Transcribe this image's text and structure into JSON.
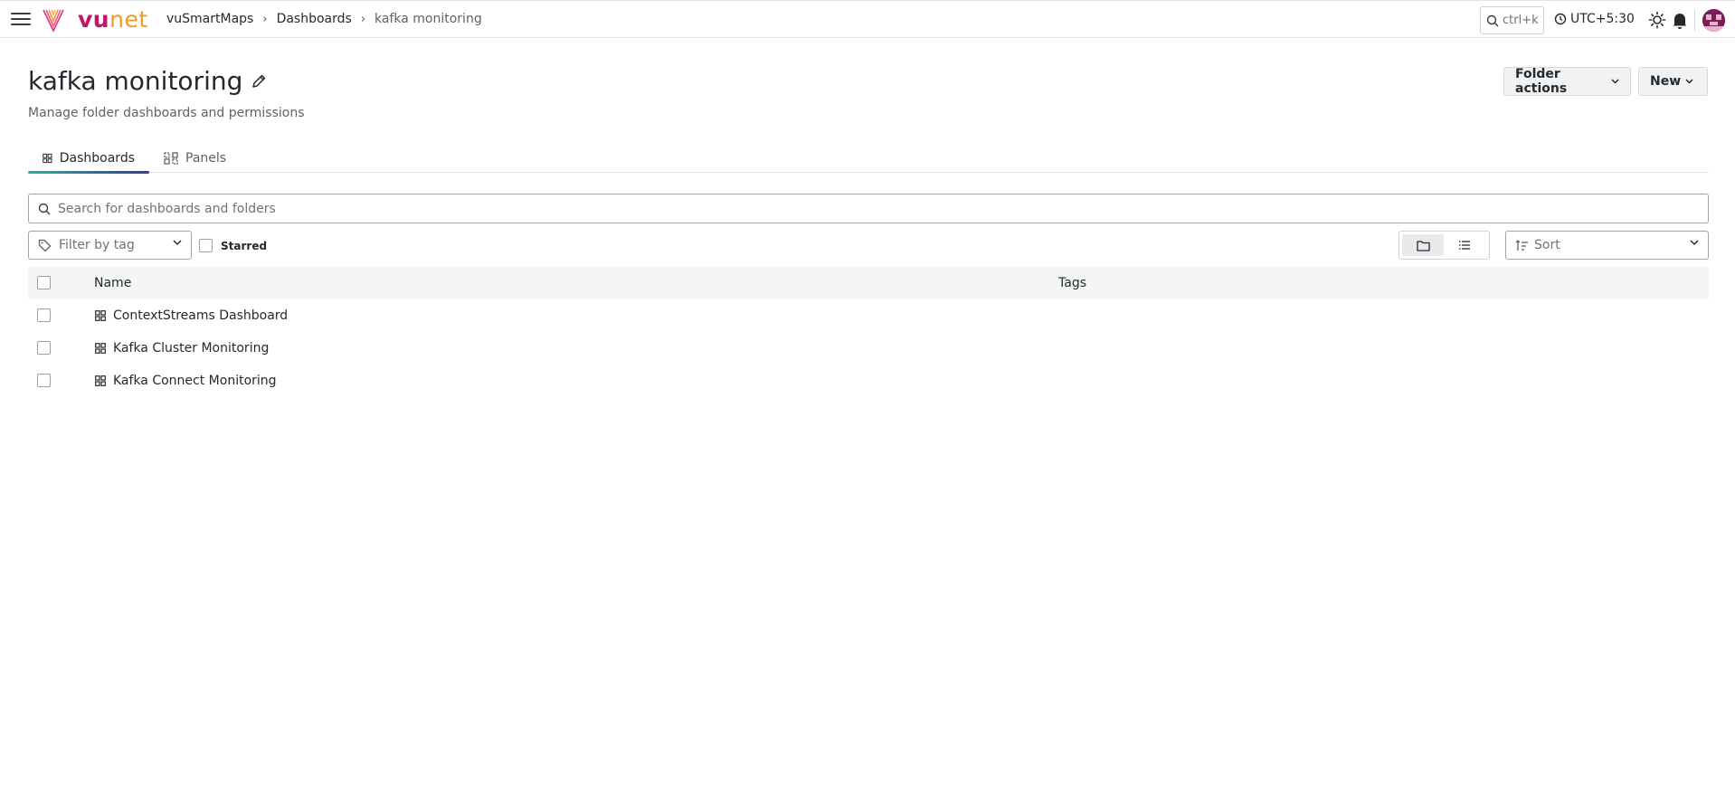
{
  "brand": {
    "logo_vu": "vu",
    "logo_net": "net"
  },
  "breadcrumb": {
    "items": [
      "vuSmartMaps",
      "Dashboards",
      "kafka monitoring"
    ]
  },
  "topbar": {
    "search_placeholder": "ctrl+k",
    "timezone": "UTC+5:30"
  },
  "page": {
    "title": "kafka monitoring",
    "subtitle": "Manage folder dashboards and permissions",
    "folder_actions_label": "Folder actions",
    "new_label": "New"
  },
  "tabs": [
    {
      "label": "Dashboards",
      "active": true
    },
    {
      "label": "Panels",
      "active": false
    }
  ],
  "search": {
    "placeholder": "Search for dashboards and folders"
  },
  "filters": {
    "tag_placeholder": "Filter by tag",
    "starred_label": "Starred",
    "sort_label": "Sort"
  },
  "table": {
    "columns": [
      "Name",
      "Tags"
    ],
    "rows": [
      {
        "name": "ContextStreams Dashboard"
      },
      {
        "name": "Kafka Cluster Monitoring"
      },
      {
        "name": "Kafka Connect Monitoring"
      }
    ]
  },
  "colors": {
    "logo_vu": "#c4126a",
    "logo_net": "#f39a1e",
    "tab_accent_start": "#22b3a3",
    "tab_accent_end": "#2f3c9e"
  }
}
